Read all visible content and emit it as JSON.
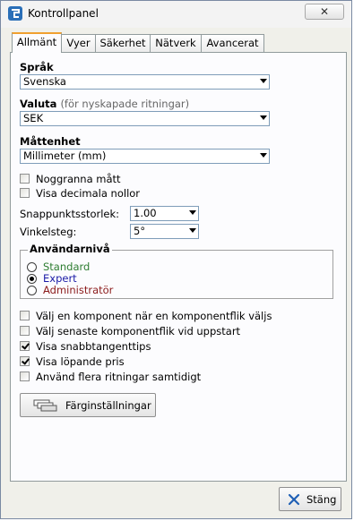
{
  "window": {
    "title": "Kontrollpanel",
    "close_label": "✕"
  },
  "tabs": [
    {
      "label": "Allmänt",
      "active": true
    },
    {
      "label": "Vyer"
    },
    {
      "label": "Säkerhet"
    },
    {
      "label": "Nätverk"
    },
    {
      "label": "Avancerat"
    }
  ],
  "language": {
    "label": "Språk",
    "value": "Svenska"
  },
  "currency": {
    "label": "Valuta",
    "sublabel": "(för nyskapade ritningar)",
    "value": "SEK"
  },
  "unit": {
    "label": "Måttenhet",
    "value": "Millimeter (mm)"
  },
  "checks_top": [
    {
      "label": "Noggranna mått",
      "checked": false
    },
    {
      "label": "Visa decimala nollor",
      "checked": false
    }
  ],
  "snap": {
    "label": "Snappunktsstorlek:",
    "value": "1.00"
  },
  "angle": {
    "label": "Vinkelsteg:",
    "value": "5°"
  },
  "user_level": {
    "title": "Användarnivå",
    "options": [
      {
        "label": "Standard",
        "color": "#2e7d32",
        "selected": false
      },
      {
        "label": "Expert",
        "color": "#1a1aa6",
        "selected": true
      },
      {
        "label": "Administratör",
        "color": "#8b1a1a",
        "selected": false
      }
    ]
  },
  "checks_bottom": [
    {
      "label": "Välj en komponent när en komponentflik väljs",
      "checked": false
    },
    {
      "label": "Välj senaste komponentflik vid uppstart",
      "checked": false
    },
    {
      "label": "Visa snabbtangenttips",
      "checked": true
    },
    {
      "label": "Visa löpande pris",
      "checked": true
    },
    {
      "label": "Använd flera ritningar samtidigt",
      "checked": false
    }
  ],
  "color_settings_button": "Färginställningar",
  "close_button": "Stäng",
  "icons": {
    "app": "app-logo-icon",
    "palette": "color-swatches-icon",
    "close": "x-close-icon"
  }
}
